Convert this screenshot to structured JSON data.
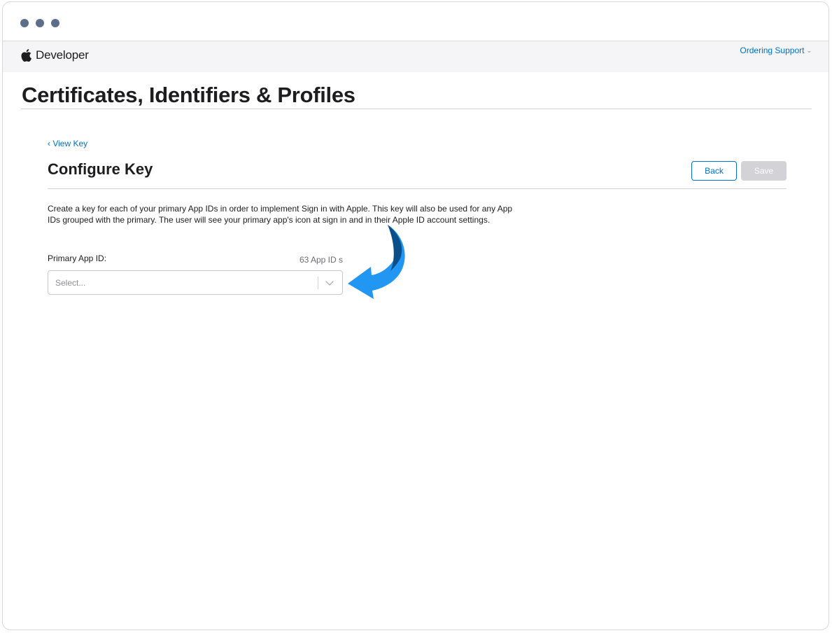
{
  "window": {
    "controls": [
      "close-dot",
      "minimize-dot",
      "zoom-dot"
    ]
  },
  "globalnav": {
    "brand_icon": "apple-logo-icon",
    "brand_text": "Developer",
    "link_label": "Ordering Support",
    "link_chevron": "⌄"
  },
  "page": {
    "title": "Certificates, Identifiers & Profiles"
  },
  "section": {
    "backlink": "‹ View Key",
    "title": "Configure Key",
    "buttons": {
      "back": "Back",
      "save": "Save"
    },
    "description": "Create a key for each of your primary App IDs in order to implement Sign in with Apple. This key will also be used for any App IDs grouped with the primary. The user will see your primary app's icon at sign in and in their Apple ID account settings."
  },
  "form": {
    "primary_app_id_label": "Primary App ID:",
    "count_text": "63 App ID s",
    "select_placeholder": "Select...",
    "select_icon": "chevron-down-icon"
  },
  "annotation": {
    "icon": "curved-arrow-icon",
    "color": "#2196f3",
    "shade": "#0b4f8a"
  },
  "colors": {
    "link": "#0070c9",
    "disabled_button": "#d2d2d7"
  }
}
